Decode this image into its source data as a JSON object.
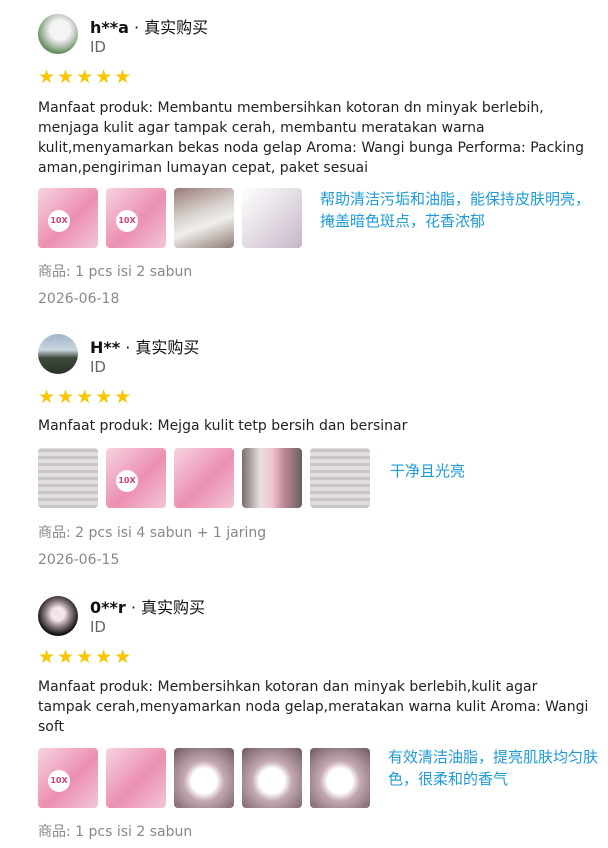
{
  "reviews": [
    {
      "username": "h**a",
      "purchase_tag": " · 真实购买",
      "region": "ID",
      "stars": "★★★★★",
      "text": "Manfaat produk: Membantu membersihkan kotoran dn minyak berlebih, menjaga kulit agar tampak cerah, membantu meratakan warna kulit,menyamarkan bekas noda gelap Aroma: Wangi bunga Performa: Packing aman,pengiriman lumayan cepat, paket sesuai",
      "translation": "帮助清洁污垢和油脂，能保持皮肤明亮，掩盖暗色斑点，花香浓郁",
      "product": "商品: 1 pcs isi 2 sabun",
      "date": "2026-06-18"
    },
    {
      "username": "H**",
      "purchase_tag": " · 真实购买",
      "region": "ID",
      "stars": "★★★★★",
      "text": "Manfaat produk: Mejga kulit tetp bersih dan bersinar",
      "translation": "干净且光亮",
      "product": "商品: 2 pcs isi 4 sabun + 1 jaring",
      "date": "2026-06-15"
    },
    {
      "username": "0**r",
      "purchase_tag": " · 真实购买",
      "region": "ID",
      "stars": "★★★★★",
      "text": "Manfaat produk: Membersihkan kotoran dan minyak berlebih,kulit agar tampak cerah,menyamarkan noda gelap,meratakan warna kulit Aroma: Wangi soft",
      "translation": "有效清洁油脂，提亮肌肤均匀肤色，很柔和的香气",
      "product": "商品: 1 pcs isi 2 sabun"
    }
  ],
  "badge_text": "10X"
}
